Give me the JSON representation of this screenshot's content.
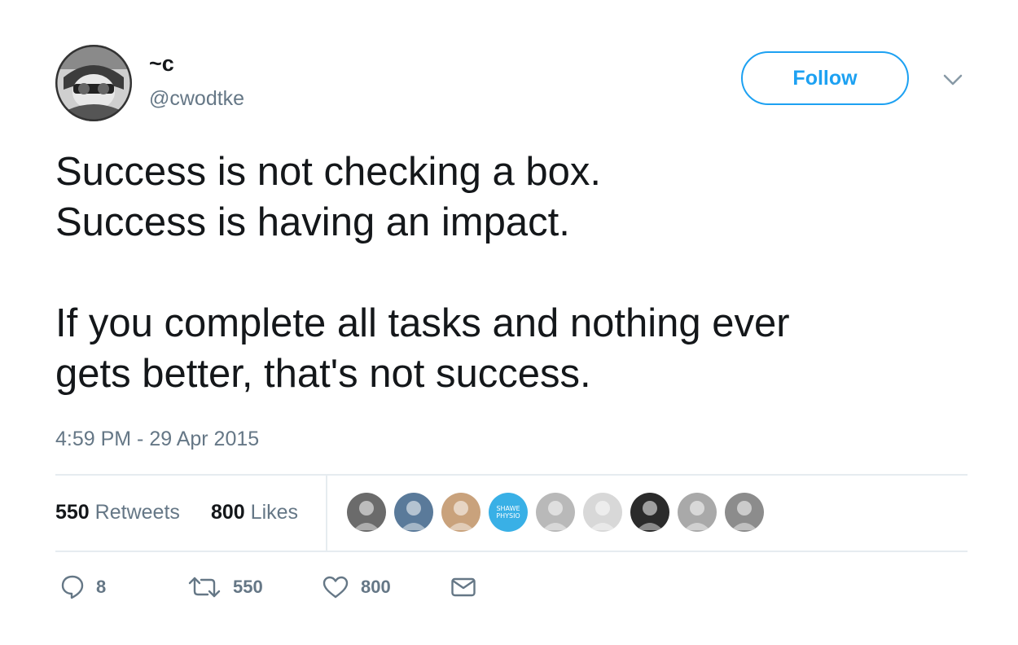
{
  "user": {
    "display_name": "~c",
    "handle": "@cwodtke",
    "avatar_icon": "profile-photo"
  },
  "follow_label": "Follow",
  "tweet": {
    "lines": [
      "Success is not checking a box.",
      "Success is having an impact.",
      "If you complete all tasks and nothing ever",
      "gets better, that's not success."
    ]
  },
  "timestamp": "4:59 PM - 29 Apr 2015",
  "stats": {
    "retweets_count": "550",
    "retweets_label": "Retweets",
    "likes_count": "800",
    "likes_label": "Likes"
  },
  "likers": [
    {
      "name": "liker-1",
      "color": "#6b6b6b"
    },
    {
      "name": "liker-2",
      "color": "#5a7a9a"
    },
    {
      "name": "liker-3",
      "color": "#c9a27c"
    },
    {
      "name": "liker-4",
      "color": "#39b0e6",
      "text": "SHAWE PHYSIO"
    },
    {
      "name": "liker-5",
      "color": "#b9b9b9"
    },
    {
      "name": "liker-6",
      "color": "#d8d8d8"
    },
    {
      "name": "liker-7",
      "color": "#2b2b2b"
    },
    {
      "name": "liker-8",
      "color": "#a9a9a9"
    },
    {
      "name": "liker-9",
      "color": "#8c8c8c"
    }
  ],
  "actions": {
    "reply_count": "8",
    "retweet_count": "550",
    "like_count": "800"
  },
  "colors": {
    "accent": "#1da1f2",
    "secondary_text": "#657786",
    "divider": "#e6ecf0",
    "primary_text": "#14171a"
  },
  "icons": {
    "reply": "reply-icon",
    "retweet": "retweet-icon",
    "like": "heart-icon",
    "message": "envelope-icon",
    "caret": "chevron-down-icon"
  }
}
